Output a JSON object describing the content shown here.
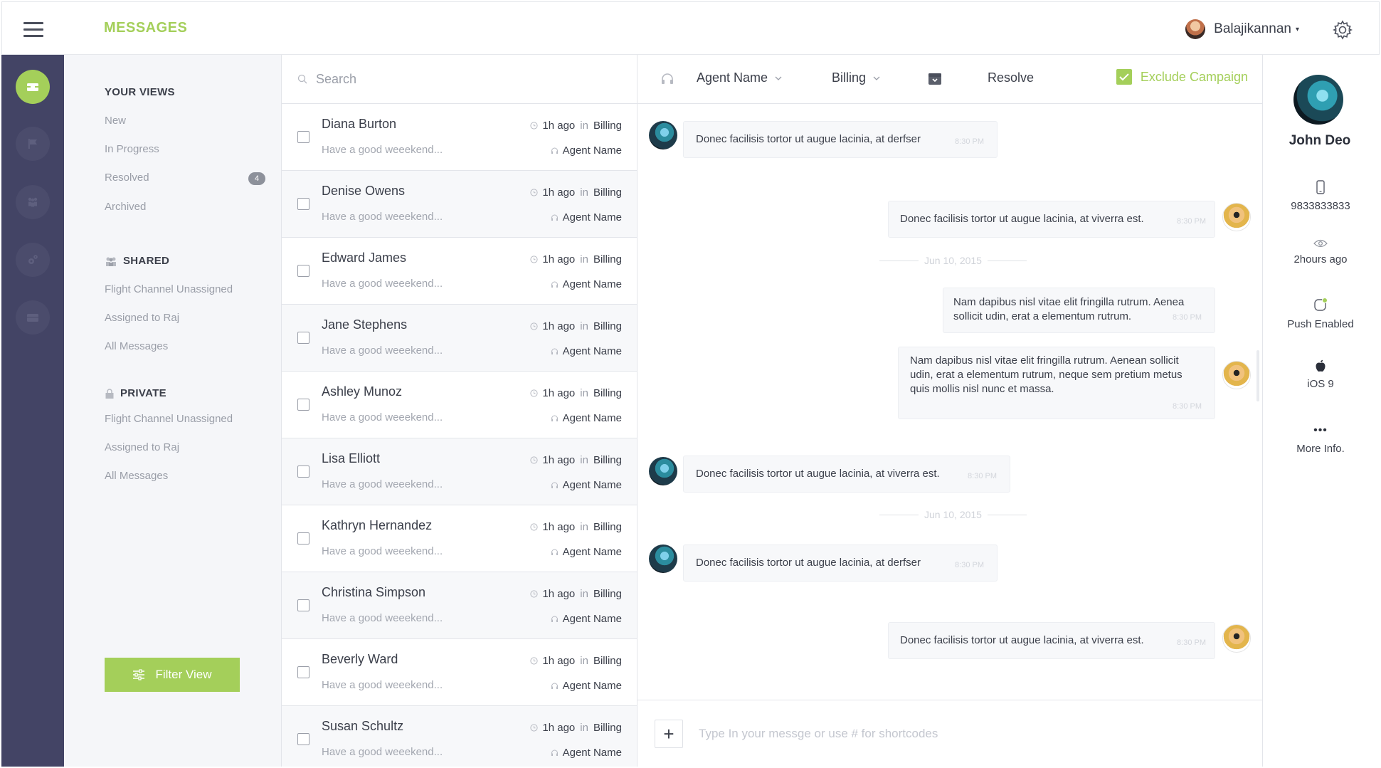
{
  "header": {
    "title": "MESSAGES",
    "user_name": "Balajikannan",
    "user_caret": "▾"
  },
  "views": {
    "your_views_heading": "YOUR VIEWS",
    "your_views": [
      "New",
      "In Progress",
      "Resolved",
      "Archived"
    ],
    "resolved_badge": "4",
    "shared_heading": "SHARED",
    "shared": [
      "Flight Channel Unassigned",
      "Assigned to Raj",
      "All Messages"
    ],
    "private_heading": "PRIVATE",
    "private": [
      "Flight Channel Unassigned",
      "Assigned to Raj",
      "All Messages"
    ],
    "filter_button": "Filter View"
  },
  "search": {
    "placeholder": "Search"
  },
  "conversations": [
    {
      "name": "Diana Burton",
      "preview": "Have a good weeekend...",
      "time": "1h ago",
      "in": "in",
      "tag": "Billing",
      "agent": "Agent Name"
    },
    {
      "name": "Denise Owens",
      "preview": "Have a good weeekend...",
      "time": "1h ago",
      "in": "in",
      "tag": "Billing",
      "agent": "Agent Name"
    },
    {
      "name": "Edward James",
      "preview": "Have a good weeekend...",
      "time": "1h ago",
      "in": "in",
      "tag": "Billing",
      "agent": "Agent Name"
    },
    {
      "name": "Jane Stephens",
      "preview": "Have a good weeekend...",
      "time": "1h ago",
      "in": "in",
      "tag": "Billing",
      "agent": "Agent Name"
    },
    {
      "name": "Ashley Munoz",
      "preview": "Have a good weeekend...",
      "time": "1h ago",
      "in": "in",
      "tag": "Billing",
      "agent": "Agent Name"
    },
    {
      "name": "Lisa Elliott",
      "preview": "Have a good weeekend...",
      "time": "1h ago",
      "in": "in",
      "tag": "Billing",
      "agent": "Agent Name"
    },
    {
      "name": "Kathryn Hernandez",
      "preview": "Have a good weeekend...",
      "time": "1h ago",
      "in": "in",
      "tag": "Billing",
      "agent": "Agent Name"
    },
    {
      "name": "Christina Simpson",
      "preview": "Have a good weeekend...",
      "time": "1h ago",
      "in": "in",
      "tag": "Billing",
      "agent": "Agent Name"
    },
    {
      "name": "Beverly Ward",
      "preview": "Have a good weeekend...",
      "time": "1h ago",
      "in": "in",
      "tag": "Billing",
      "agent": "Agent Name"
    },
    {
      "name": "Susan Schultz",
      "preview": "Have a good weeekend...",
      "time": "1h ago",
      "in": "in",
      "tag": "Billing",
      "agent": "Agent Name"
    }
  ],
  "chat_toolbar": {
    "agent_dropdown": "Agent Name",
    "category_dropdown": "Billing",
    "resolve": "Resolve",
    "exclude_campaign": "Exclude Campaign"
  },
  "messages": [
    {
      "text": "Donec facilisis tortor ut augue lacinia, at derfser",
      "time": "8:30 PM"
    },
    {
      "text": "Donec facilisis tortor ut augue lacinia, at viverra est.",
      "time": "8:30 PM"
    },
    {
      "text": "Nam dapibus nisl vitae elit fringilla rutrum. Aenea sollicit udin, erat a elementum rutrum.",
      "time": "8:30 PM"
    },
    {
      "text": "Nam dapibus nisl vitae elit fringilla rutrum. Aenean sollicit udin, erat a elementum rutrum, neque sem pretium metus quis mollis nisl nunc et massa.",
      "time": "8:30 PM"
    },
    {
      "text": "Donec facilisis tortor ut augue lacinia, at viverra est.",
      "time": "8:30 PM"
    },
    {
      "text": "Donec facilisis tortor ut augue lacinia, at derfser",
      "time": "8:30 PM"
    },
    {
      "text": "Donec facilisis tortor ut augue lacinia, at viverra est.",
      "time": "8:30 PM"
    }
  ],
  "dividers": [
    "Jun 10, 2015",
    "Jun 10, 2015"
  ],
  "composer": {
    "placeholder": "Type In your messge or use # for shortcodes",
    "plus": "+"
  },
  "profile": {
    "name": "John Deo",
    "phone": "9833833833",
    "last_seen": "2hours ago",
    "push": "Push Enabled",
    "os": "iOS 9",
    "more": "More Info.",
    "more_dots": "•••"
  },
  "colors": {
    "accent": "#a4cf5a",
    "rail": "#434465",
    "text": "#3b3f4a",
    "muted": "#9a9ea8"
  }
}
